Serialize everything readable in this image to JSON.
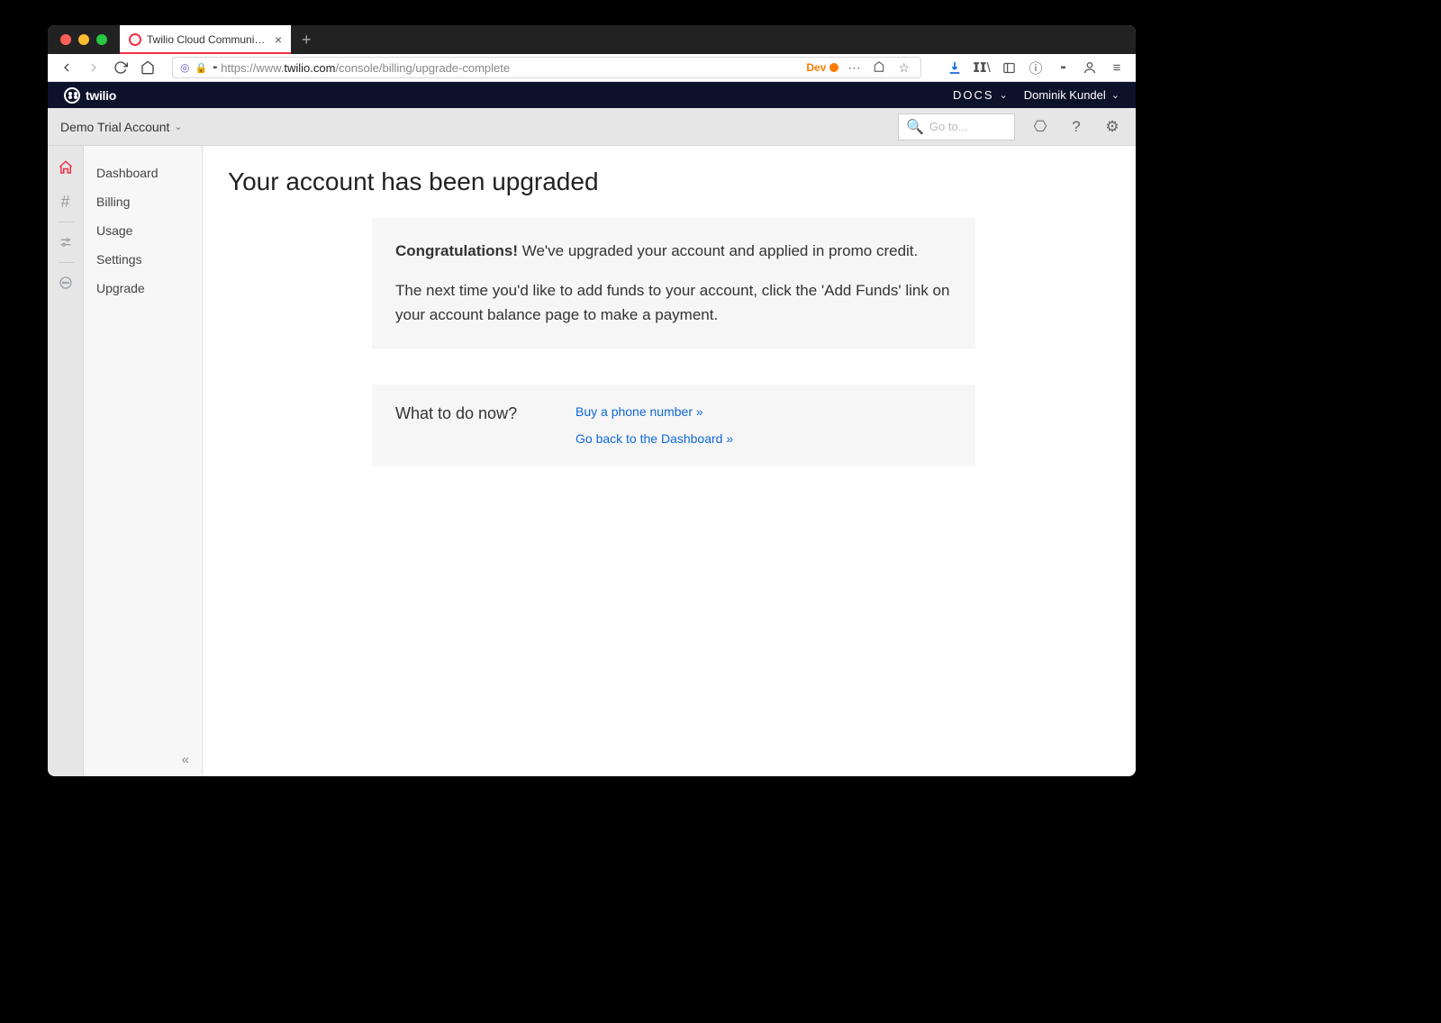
{
  "browser": {
    "tab_title": "Twilio Cloud Communications |",
    "url_prefix": "https://www.",
    "url_domain": "twilio.com",
    "url_path": "/console/billing/upgrade-complete",
    "dev_label": "Dev"
  },
  "topbar": {
    "logo_text": "twilio",
    "docs": "DOCS",
    "user": "Dominik Kundel"
  },
  "account_bar": {
    "account_name": "Demo Trial Account",
    "search_placeholder": "Go to..."
  },
  "sidebar": {
    "items": [
      "Dashboard",
      "Billing",
      "Usage",
      "Settings",
      "Upgrade"
    ]
  },
  "main": {
    "page_title": "Your account has been upgraded",
    "congrats_label": "Congratulations!",
    "congrats_text": " We've upgraded your account and applied in promo credit.",
    "next_text": "The next time you'd like to add funds to your account, click the 'Add Funds' link on your account balance page to make a payment.",
    "what_now": "What to do now?",
    "link_buy": "Buy a phone number »",
    "link_dash": "Go back to the Dashboard »"
  }
}
